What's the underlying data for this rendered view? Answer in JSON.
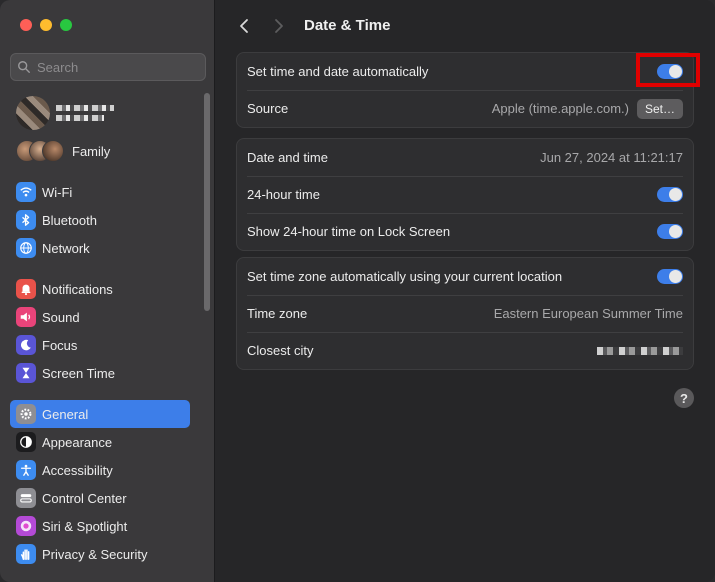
{
  "window": {
    "title": "Date & Time"
  },
  "sidebar": {
    "search_placeholder": "Search",
    "family_label": "Family",
    "groups": [
      [
        {
          "id": "wifi",
          "label": "Wi-Fi",
          "icon": "wifi-icon",
          "color": "#3d8cf0"
        },
        {
          "id": "bluetooth",
          "label": "Bluetooth",
          "icon": "bluetooth-icon",
          "color": "#3d8cf0"
        },
        {
          "id": "network",
          "label": "Network",
          "icon": "globe-icon",
          "color": "#3d8cf0"
        }
      ],
      [
        {
          "id": "notifications",
          "label": "Notifications",
          "icon": "bell-icon",
          "color": "#e9524a"
        },
        {
          "id": "sound",
          "label": "Sound",
          "icon": "speaker-icon",
          "color": "#e9447a"
        },
        {
          "id": "focus",
          "label": "Focus",
          "icon": "moon-icon",
          "color": "#5a55d6"
        },
        {
          "id": "screen-time",
          "label": "Screen Time",
          "icon": "hourglass-icon",
          "color": "#5a55d6"
        }
      ],
      [
        {
          "id": "general",
          "label": "General",
          "icon": "gear-icon",
          "color": "#8e8e93",
          "active": true
        },
        {
          "id": "appearance",
          "label": "Appearance",
          "icon": "appearance-icon",
          "color": "#1c1c1e"
        },
        {
          "id": "accessibility",
          "label": "Accessibility",
          "icon": "accessibility-icon",
          "color": "#3d8cf0"
        },
        {
          "id": "control-center",
          "label": "Control Center",
          "icon": "switches-icon",
          "color": "#8e8e93"
        },
        {
          "id": "siri",
          "label": "Siri & Spotlight",
          "icon": "siri-icon",
          "color": "#b44ad6"
        },
        {
          "id": "privacy",
          "label": "Privacy & Security",
          "icon": "hand-icon",
          "color": "#3d8cf0"
        }
      ]
    ]
  },
  "main": {
    "title": "Date & Time",
    "auto_group": {
      "set_auto_label": "Set time and date automatically",
      "set_auto_on": true,
      "source_label": "Source",
      "source_value": "Apple (time.apple.com.)",
      "set_button": "Set…"
    },
    "time_group": {
      "date_time_label": "Date and time",
      "date_time_value": "Jun 27, 2024 at 11:21:17",
      "h24_label": "24-hour time",
      "h24_on": true,
      "lock_label": "Show 24-hour time on Lock Screen",
      "lock_on": true
    },
    "zone_group": {
      "auto_zone_label": "Set time zone automatically using your current location",
      "auto_zone_on": true,
      "time_zone_label": "Time zone",
      "time_zone_value": "Eastern European Summer Time",
      "closest_city_label": "Closest city"
    },
    "help_label": "?"
  },
  "colors": {
    "accent": "#3d7ee9",
    "highlight": "#e00000"
  }
}
